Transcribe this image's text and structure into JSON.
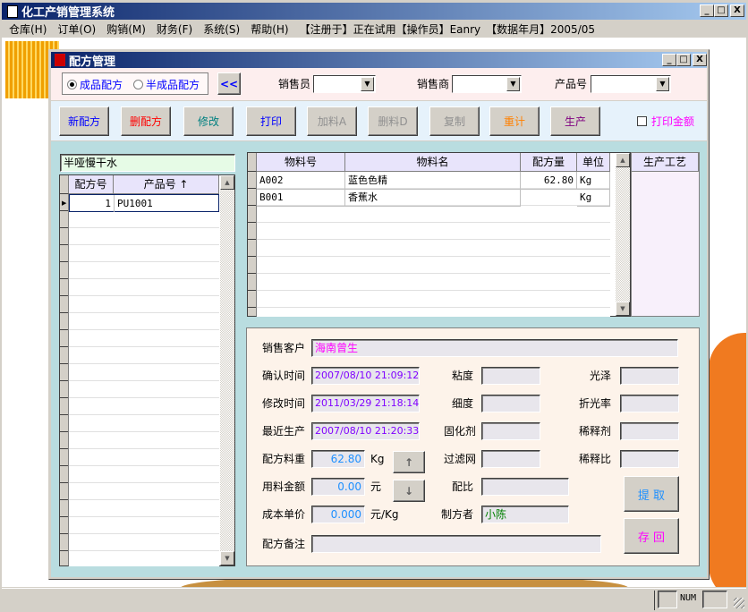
{
  "app": {
    "title": "化工产销管理系统"
  },
  "menu": [
    "仓库(H)",
    "订单(O)",
    "购销(M)",
    "财务(F)",
    "系统(S)",
    "帮助(H)"
  ],
  "menu_info": "【注册于】正在试用【操作员】Eanry　【数据年月】2005/05",
  "window": {
    "title": "配方管理"
  },
  "filters": {
    "radio_finished": "成品配方",
    "radio_semi": "半成品配方",
    "collapse": "<<",
    "salesperson_label": "销售员",
    "salesperson_value": "",
    "dealer_label": "销售商",
    "dealer_value": "",
    "product_label": "产品号",
    "product_value": ""
  },
  "toolbar": {
    "new": "新配方",
    "delete": "删配方",
    "edit": "修改",
    "print": "打印",
    "add_material": "加料A",
    "del_material": "删料D",
    "copy": "复制",
    "recalc": "重计",
    "produce": "生产",
    "print_amount": "打印金额"
  },
  "colors": {
    "new": "#0000ff",
    "delete": "#ff0000",
    "edit": "#008080",
    "print": "#0000ff",
    "disabled": "#808080",
    "recalc": "#ff8000",
    "produce": "#800080",
    "print_amount": "#ff00ff"
  },
  "left": {
    "name": "半哑慢干水",
    "headers": [
      "配方号",
      "产品号 ↑"
    ],
    "rows": [
      [
        "1",
        "PU1001"
      ]
    ]
  },
  "materials": {
    "headers": [
      "物料号",
      "物料名",
      "配方量",
      "单位"
    ],
    "rows": [
      [
        "A002",
        "蓝色色精",
        "62.80",
        "Kg"
      ],
      [
        "B001",
        "香蕉水",
        "",
        "Kg"
      ]
    ],
    "process_header": "生产工艺"
  },
  "details": {
    "customer_label": "销售客户",
    "customer": "海南曾生",
    "confirm_label": "确认时间",
    "confirm": "2007/08/10 21:09:12",
    "modify_label": "修改时间",
    "modify": "2011/03/29 21:18:14",
    "recent_label": "最近生产",
    "recent": "2007/08/10 21:20:33",
    "weight_label": "配方料重",
    "weight": "62.80",
    "weight_unit": "Kg",
    "amount_label": "用料金额",
    "amount": "0.00",
    "amount_unit": "元",
    "cost_label": "成本单价",
    "cost": "0.000",
    "cost_unit": "元/Kg",
    "note_label": "配方备注",
    "note": "",
    "viscosity_label": "粘度",
    "fineness_label": "细度",
    "curing_label": "固化剂",
    "filter_label": "过滤网",
    "ratio_label": "配比",
    "maker_label": "制方者",
    "maker": "小陈",
    "gloss_label": "光泽",
    "refract_label": "折光率",
    "thinner_label": "稀释剂",
    "dilution_label": "稀释比",
    "up": "↑",
    "down": "↓",
    "fetch": "提 取",
    "save": "存 回"
  },
  "status": {
    "num": "NUM"
  }
}
